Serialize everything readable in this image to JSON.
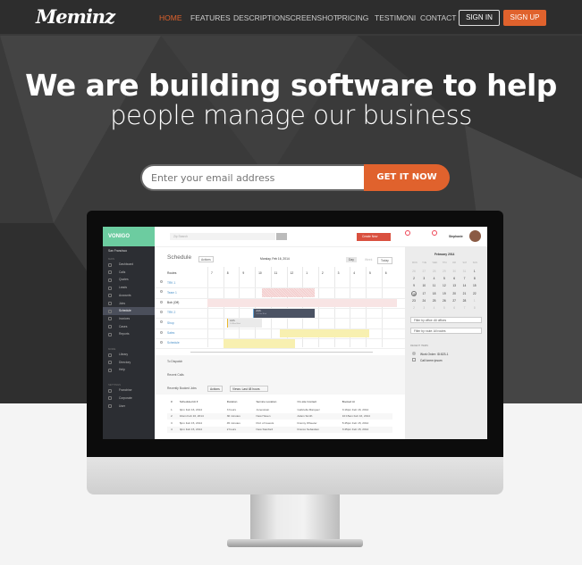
{
  "nav": {
    "logo": "Meminz",
    "items": [
      "HOME",
      "FEATURES",
      "DESCRIPTION",
      "SCREENSHOT",
      "PRICING",
      "TESTIMONI",
      "CONTACT"
    ],
    "active": "HOME",
    "sign_in": "SIGN IN",
    "sign_up": "SIGN UP"
  },
  "hero": {
    "title": "We are building software to help",
    "subtitle": "people manage our business",
    "email_placeholder": "Enter your email address",
    "cta": "GET IT NOW"
  },
  "colors": {
    "accent": "#e0622d",
    "brand_green": "#6ccca0"
  },
  "app": {
    "logo": "VONIGO",
    "location": "San Francisco",
    "search_placeholder": "Zip Search",
    "create_new": "Create New",
    "user": "Stephanie",
    "sidebar": [
      {
        "h": "MAIN",
        "items": [
          "Dashboard",
          "Calls",
          "Quotes",
          "Leads",
          "Accounts",
          "Jobs",
          "Schedule",
          "Invoices",
          "Cases",
          "Reports"
        ]
      },
      {
        "h": "MORE",
        "items": [
          "Library",
          "Directory",
          "Help"
        ]
      },
      {
        "h": "SETTINGS",
        "items": [
          "Franchise",
          "Corporate",
          "User"
        ]
      }
    ],
    "active_item": "Schedule",
    "schedule": {
      "title": "Schedule",
      "actions": "Actions",
      "date": "Monday, Feb 16, 2014",
      "views": [
        "Day",
        "Week"
      ],
      "today": "Today",
      "routes_label": "Routes",
      "hours": [
        "7",
        "8",
        "9",
        "10",
        "11",
        "12",
        "1",
        "2",
        "3",
        "4",
        "5",
        "6"
      ],
      "routes": [
        "TRK 1",
        "Team 1",
        "Bob (Off)",
        "TRK 2",
        "Shop",
        "Sales",
        "Schedule"
      ],
      "events": [
        {
          "label": "Arch.",
          "sub": "14 Elm Blvd"
        },
        {
          "label": "Arch.",
          "sub": "14 Elm Blvd"
        }
      ]
    },
    "sections": [
      "To Dispatch",
      "Recent Calls"
    ],
    "booked": {
      "title": "Recently Booked Jobs",
      "actions": "Actions",
      "views": "Views: Last 48 hours",
      "columns": [
        "#",
        "Scheduled At ▾",
        "Duration",
        "Service Location",
        "On-site Contact",
        "Booked At"
      ],
      "rows": [
        [
          "1",
          "3pm Feb 16, 2014",
          "3 hours",
          "Jonestown",
          "Gabriella Marquez",
          "3:16pm Feb 16, 2014"
        ],
        [
          "2",
          "10am Feb 16, 2014",
          "30 minutes",
          "New Haven",
          "Adam Smith",
          "10:15am Feb 16, 2014"
        ],
        [
          "3",
          "5pm Feb 15, 2014",
          "45 minutes",
          "Port of Guests",
          "Franny Wheeler",
          "5:45pm Feb 15, 2014"
        ],
        [
          "4",
          "3pm Feb 15, 2014",
          "2 hours",
          "New Stanford",
          "Franco Sebastian",
          "3:45pm Feb 15, 2014"
        ]
      ]
    },
    "calendar": {
      "month": "February 2014",
      "days": [
        "MON",
        "TUE",
        "WED",
        "THU",
        "FRI",
        "SAT",
        "SUN"
      ],
      "weeks": [
        [
          "26",
          "27",
          "28",
          "29",
          "30",
          "31",
          "1"
        ],
        [
          "2",
          "3",
          "4",
          "5",
          "6",
          "7",
          "8"
        ],
        [
          "9",
          "10",
          "11",
          "12",
          "13",
          "14",
          "15"
        ],
        [
          "16",
          "17",
          "18",
          "19",
          "20",
          "21",
          "22"
        ],
        [
          "23",
          "24",
          "25",
          "26",
          "27",
          "28",
          "1"
        ],
        [
          "2",
          "3",
          "4",
          "5",
          "6",
          "7",
          "8"
        ]
      ],
      "selected": "16"
    },
    "filters": [
      "Filter by office: All offices",
      "Filter by route: All routes"
    ],
    "recent_label": "RECENT ITEMS",
    "recent": [
      "Work Order: ID:823-1",
      "Call lorem ipsum"
    ]
  }
}
